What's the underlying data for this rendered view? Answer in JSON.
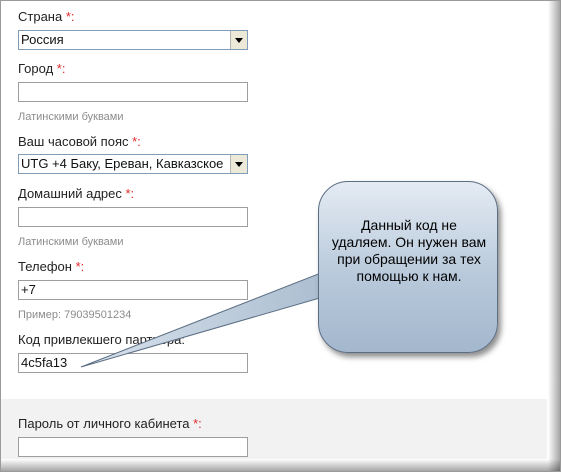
{
  "form": {
    "country": {
      "label": "Страна",
      "required_mark": "*:",
      "value": "Россия"
    },
    "city": {
      "label": "Город",
      "required_mark": "*:",
      "value": "",
      "hint": "Латинскими буквами"
    },
    "timezone": {
      "label": "Ваш часовой пояс",
      "required_mark": "*:",
      "value": "UTG +4 Баку, Ереван, Кавказское"
    },
    "address": {
      "label": "Домашний адрес",
      "required_mark": "*:",
      "value": "",
      "hint": "Латинскими буквами"
    },
    "phone": {
      "label": "Телефон",
      "required_mark": "*:",
      "value": "+7",
      "hint": "Пример: 79039501234"
    },
    "referrer": {
      "label": "Код привлекшего партнера:",
      "value": "4c5fa13"
    },
    "password": {
      "label": "Пароль от личного кабинета",
      "required_mark": "*:",
      "value": ""
    }
  },
  "callout": {
    "text": "Данный код не удаляем. Он нужен вам при обращении за тех помощью к нам."
  },
  "colors": {
    "required": "#e02a2a",
    "hint": "#8c8c8c",
    "bubble_top": "#e4ebf3",
    "bubble_bottom": "#a3b7cd"
  }
}
